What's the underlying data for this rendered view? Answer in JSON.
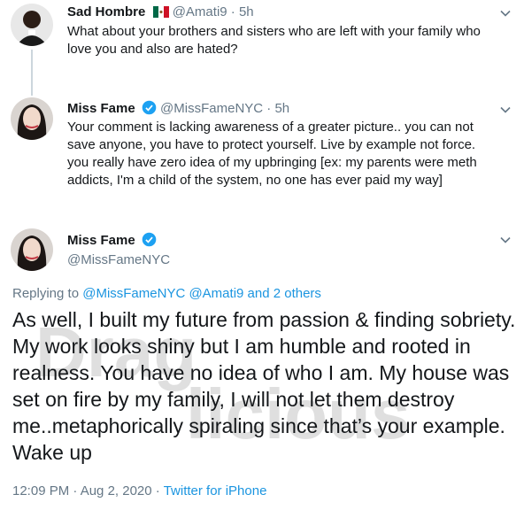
{
  "tweet1": {
    "name": "Sad Hombre",
    "handle": "@Amati9",
    "separator": "·",
    "time": "5h",
    "text": "What about your brothers and sisters who are left with your family who love you and also are hated?"
  },
  "tweet2": {
    "name": "Miss Fame",
    "handle": "@MissFameNYC",
    "separator": "·",
    "time": "5h",
    "text": "Your comment is lacking awareness of a greater picture.. you can not save anyone, you have to protect yourself. Live by example not force. you really have zero idea of my upbringing [ex: my parents were meth addicts, I'm a child of the system, no one has ever paid my way]"
  },
  "main_tweet": {
    "name": "Miss Fame",
    "handle": "@MissFameNYC",
    "replying_prefix": "Replying to",
    "replying_to": "@MissFameNYC @Amati9 and 2 others",
    "text": "As well, I built my future from passion & finding sobriety. My work looks shiny but I am humble and rooted in realness. You have no idea of who I am. My house was set on fire by my family, I will not let them destroy me..metaphorically spiraling since that’s your example. Wake up",
    "timestamp": "12:09 PM · Aug 2, 2020",
    "separator": "·",
    "source": "Twitter for iPhone"
  },
  "watermark": {
    "line1": "Drag",
    "line2": "licious"
  },
  "colors": {
    "link": "#1b95e0",
    "secondary": "#657786",
    "verified": "#1da1f2",
    "thread_line": "#ccd6dd"
  },
  "icons": {
    "verified": "verified-badge-icon",
    "flag": "mexico-flag-icon",
    "chevron": "chevron-down-icon"
  }
}
